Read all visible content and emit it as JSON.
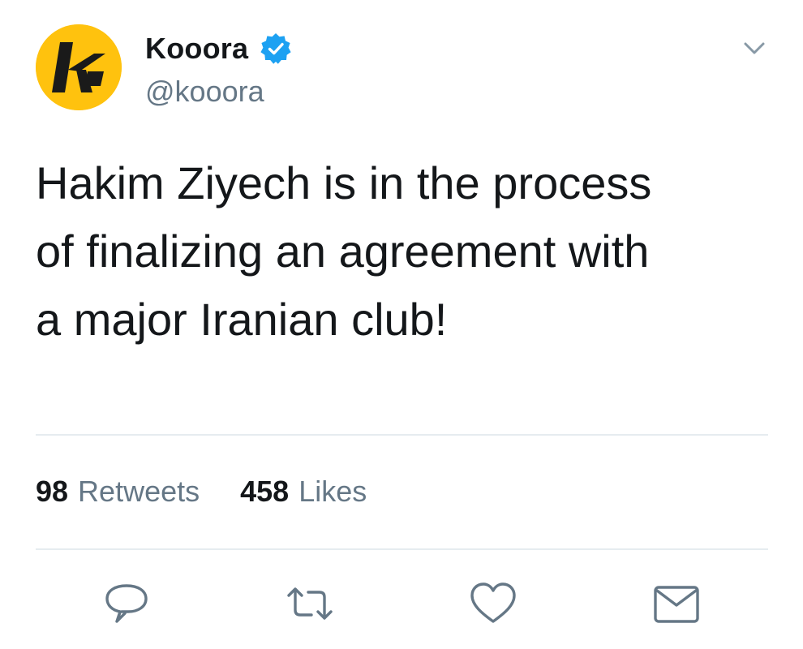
{
  "tweet": {
    "display_name": "Kooora",
    "handle": "@kooora",
    "verified_icon": "verified-badge-icon",
    "text": "Hakim Ziyech is in the process\nof finalizing an agreement with\na major Iranian club!",
    "avatar_letter": "k",
    "retweets_count": "98",
    "retweets_label": "Retweets",
    "likes_count": "458",
    "likes_label": "Likes"
  },
  "icons": {
    "menu": "chevron-down-icon",
    "reply": "reply-icon",
    "retweet": "retweet-icon",
    "like": "heart-icon",
    "share": "envelope-icon"
  },
  "colors": {
    "avatar_bg": "#ffc20e",
    "verified": "#1da1f2",
    "muted": "#657786",
    "text": "#14171a",
    "divider": "#e6ecf0"
  }
}
